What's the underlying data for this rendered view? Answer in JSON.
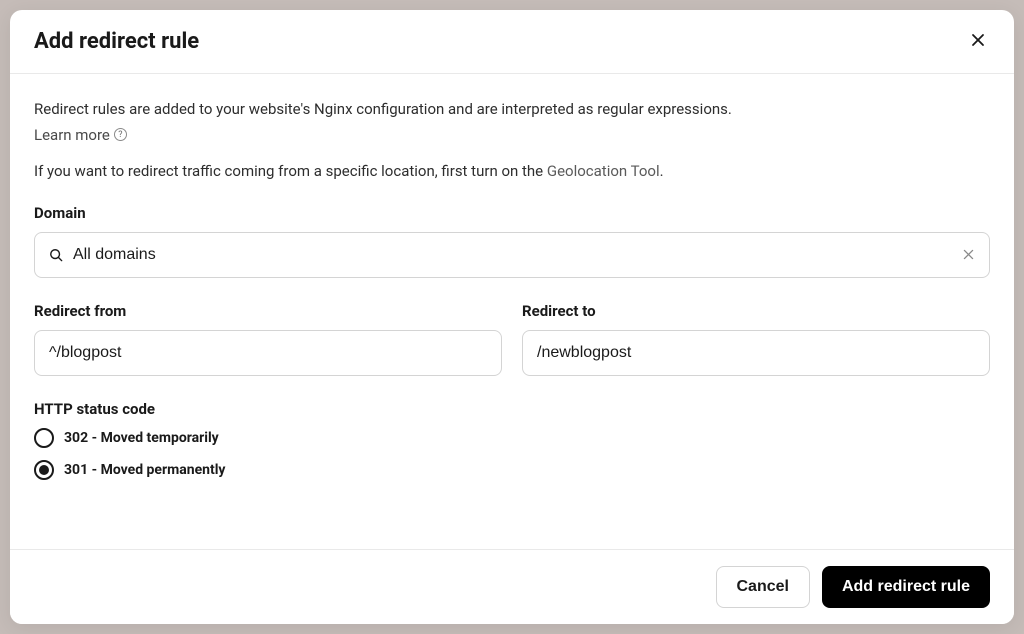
{
  "modal": {
    "title": "Add redirect rule",
    "description": "Redirect rules are added to your website's Nginx configuration and are interpreted as regular expressions.",
    "learn_more": "Learn more",
    "geo_prefix": "If you want to redirect traffic coming from a specific location, first turn on the ",
    "geo_link": "Geolocation Tool",
    "geo_suffix": "."
  },
  "domain": {
    "label": "Domain",
    "value": "All domains"
  },
  "redirect_from": {
    "label": "Redirect from",
    "value": "^/blogpost"
  },
  "redirect_to": {
    "label": "Redirect to",
    "value": "/newblogpost"
  },
  "status": {
    "label": "HTTP status code",
    "options": [
      {
        "label": "302 - Moved temporarily",
        "checked": false
      },
      {
        "label": "301 - Moved permanently",
        "checked": true
      }
    ]
  },
  "footer": {
    "cancel": "Cancel",
    "submit": "Add redirect rule"
  }
}
